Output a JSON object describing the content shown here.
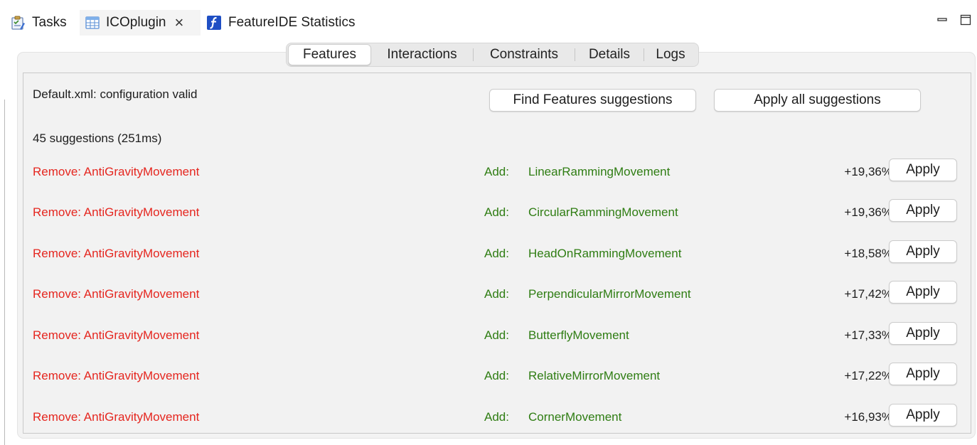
{
  "tabs": [
    {
      "label": "Tasks",
      "icon": "tasks-icon"
    },
    {
      "label": "ICOplugin",
      "icon": "grid-view-icon",
      "active": true,
      "closable": true
    },
    {
      "label": "FeatureIDE Statistics",
      "icon": "featureide-icon"
    }
  ],
  "segments": [
    {
      "label": "Features",
      "selected": true
    },
    {
      "label": "Interactions"
    },
    {
      "label": "Constraints"
    },
    {
      "label": "Details"
    },
    {
      "label": "Logs"
    }
  ],
  "status": "Default.xml: configuration valid",
  "buttons": {
    "find": "Find Features suggestions",
    "apply_all": "Apply all suggestions"
  },
  "summary": "45 suggestions (251ms)",
  "rows": [
    {
      "remove": "Remove: AntiGravityMovement",
      "add_label": "Add:",
      "add": "LinearRammingMovement",
      "pct": "+19,36%",
      "apply": "Apply"
    },
    {
      "remove": "Remove: AntiGravityMovement",
      "add_label": "Add:",
      "add": "CircularRammingMovement",
      "pct": "+19,36%",
      "apply": "Apply"
    },
    {
      "remove": "Remove: AntiGravityMovement",
      "add_label": "Add:",
      "add": "HeadOnRammingMovement",
      "pct": "+18,58%",
      "apply": "Apply"
    },
    {
      "remove": "Remove: AntiGravityMovement",
      "add_label": "Add:",
      "add": "PerpendicularMirrorMovement",
      "pct": "+17,42%",
      "apply": "Apply"
    },
    {
      "remove": "Remove: AntiGravityMovement",
      "add_label": "Add:",
      "add": "ButterflyMovement",
      "pct": "+17,33%",
      "apply": "Apply"
    },
    {
      "remove": "Remove: AntiGravityMovement",
      "add_label": "Add:",
      "add": "RelativeMirrorMovement",
      "pct": "+17,22%",
      "apply": "Apply"
    },
    {
      "remove": "Remove: AntiGravityMovement",
      "add_label": "Add:",
      "add": "CornerMovement",
      "pct": "+16,93%",
      "apply": "Apply"
    }
  ],
  "colors": {
    "remove": "#e5261f",
    "add": "#2f7d13",
    "panel": "#f3f3f3"
  }
}
